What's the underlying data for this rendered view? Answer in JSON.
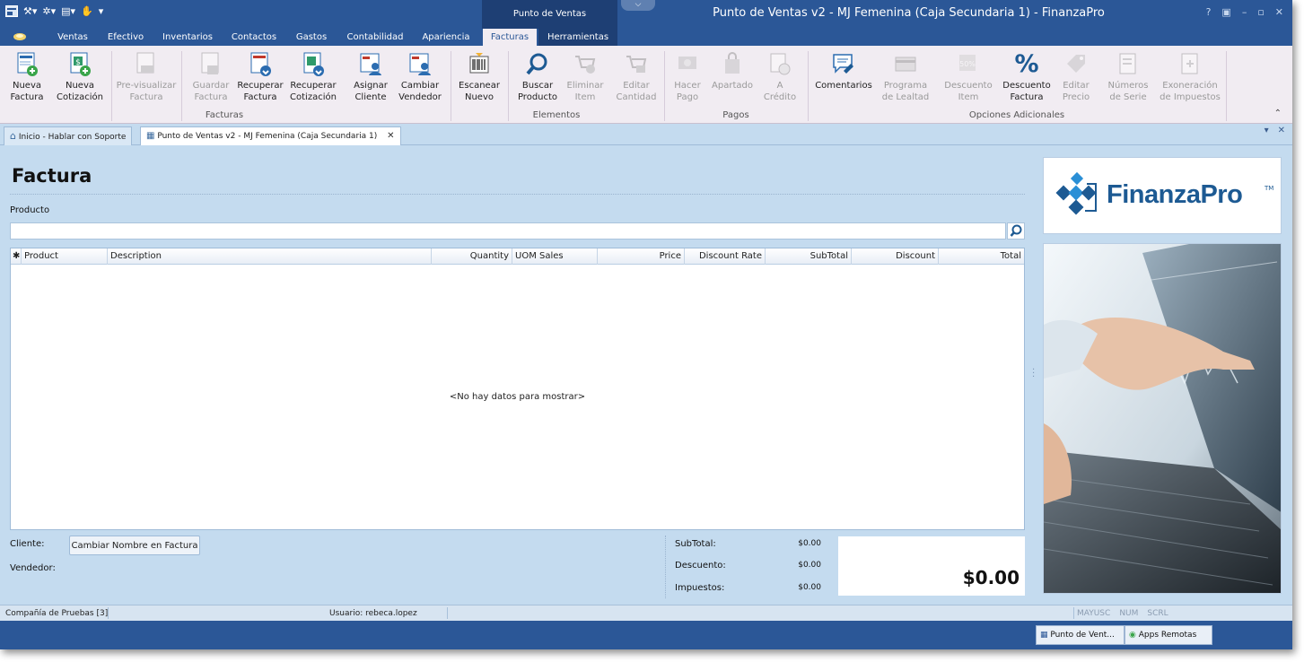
{
  "window": {
    "title": "Punto de Ventas v2 - MJ Femenina (Caja Secundaria 1) - FinanzaPro",
    "context_group": "Punto de Ventas",
    "controls": [
      "?",
      "▣",
      "–",
      "▫",
      "✕"
    ]
  },
  "ribbon_tabs": [
    {
      "label": "Ventas"
    },
    {
      "label": "Efectivo"
    },
    {
      "label": "Inventarios"
    },
    {
      "label": "Contactos"
    },
    {
      "label": "Gastos"
    },
    {
      "label": "Contabilidad"
    },
    {
      "label": "Apariencia"
    },
    {
      "label": "Facturas"
    },
    {
      "label": "Herramientas"
    }
  ],
  "ribbon": {
    "groups": {
      "facturas": "Facturas",
      "elementos": "Elementos",
      "pagos": "Pagos",
      "opciones": "Opciones Adicionales"
    },
    "buttons": {
      "nueva_factura": "Nueva\nFactura",
      "nueva_cotizacion": "Nueva\nCotización",
      "previsualizar": "Pre-visualizar\nFactura",
      "guardar": "Guardar\nFactura",
      "recuperar_factura": "Recuperar\nFactura",
      "recuperar_cotizacion": "Recuperar\nCotización",
      "asignar_cliente": "Asignar\nCliente",
      "cambiar_vendedor": "Cambiar\nVendedor",
      "escanear": "Escanear\nNuevo",
      "buscar": "Buscar\nProducto",
      "eliminar": "Eliminar\nItem",
      "editar_cantidad": "Editar\nCantidad",
      "hacer_pago": "Hacer\nPago",
      "apartado": "Apartado",
      "a_credito": "A\nCrédito",
      "comentarios": "Comentarios",
      "programa_lealtad": "Programa\nde Lealtad",
      "descuento_item": "Descuento\nItem",
      "descuento_factura": "Descuento\nFactura",
      "editar_precio": "Editar\nPrecio",
      "numeros_serie": "Números\nde Serie",
      "exoneracion": "Exoneración\nde Impuestos"
    }
  },
  "doc_tabs": [
    {
      "label": "Inicio - Hablar con Soporte"
    },
    {
      "label": "Punto de Ventas v2 - MJ Femenina (Caja Secundaria 1)"
    }
  ],
  "invoice": {
    "title": "Factura",
    "product_label": "Producto",
    "product_value": "",
    "columns": [
      "Product",
      "Description",
      "Quantity",
      "UOM Sales",
      "Price",
      "Discount Rate",
      "SubTotal",
      "Discount",
      "Total"
    ],
    "new_row_marker": "✱",
    "empty_text": "<No hay datos para mostrar>",
    "cliente_label": "Cliente:",
    "cambiar_nombre": "Cambiar Nombre en Factura",
    "vendedor_label": "Vendedor:",
    "totals": {
      "subtotal_label": "SubTotal:",
      "subtotal": "$0.00",
      "descuento_label": "Descuento:",
      "descuento": "$0.00",
      "impuestos_label": "Impuestos:",
      "impuestos": "$0.00",
      "grand_total": "$0.00"
    }
  },
  "brand": {
    "name_part1": "Finanza",
    "name_part2": "Pro",
    "tm": "TM"
  },
  "status": {
    "company": "Compañía de Pruebas [3]",
    "user": "Usuario: rebeca.lopez",
    "keys": [
      "MAYUSC",
      "NUM",
      "SCRL"
    ]
  },
  "taskbar": [
    {
      "label": "Punto de Vent..."
    },
    {
      "label": "Apps Remotas"
    }
  ],
  "colors": {
    "title_bar": "#2b5797",
    "ribbon_bg": "#f1ecf2",
    "content_bg": "#c4dbef",
    "brand_blue": "#1d5a93"
  }
}
